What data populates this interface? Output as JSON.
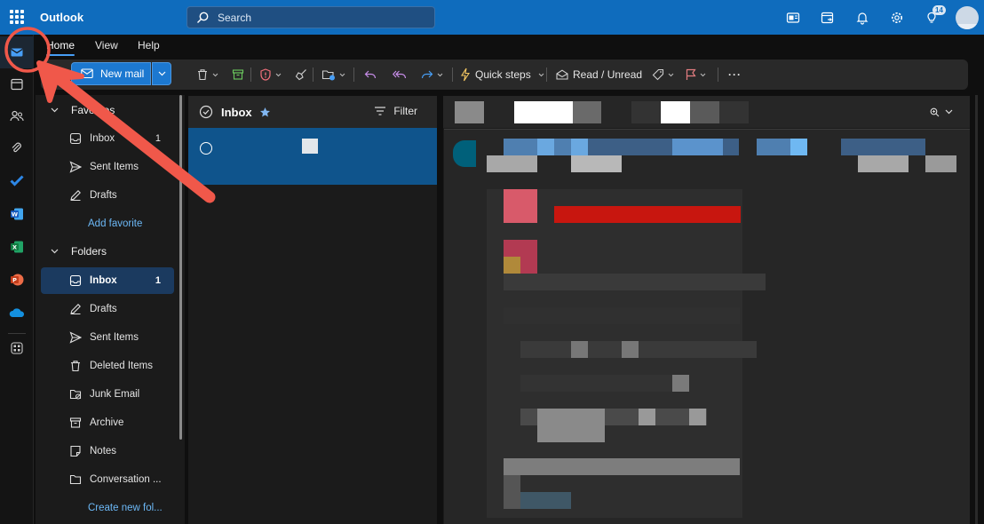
{
  "app": {
    "title": "Outlook"
  },
  "search": {
    "placeholder": "Search"
  },
  "topbar": {
    "icons": [
      "teams-meeting-icon",
      "my-day-icon",
      "bell-icon",
      "gear-icon",
      "lightbulb-icon"
    ],
    "tips_badge": "14"
  },
  "rail": {
    "items": [
      "mail-icon",
      "calendar-icon",
      "people-icon",
      "attach-icon",
      "todo-icon",
      "word-icon",
      "excel-icon",
      "powerpoint-icon",
      "onedrive-icon",
      "more-apps-icon"
    ]
  },
  "ribbon": {
    "tabs": [
      {
        "label": "Home"
      },
      {
        "label": "View"
      },
      {
        "label": "Help"
      }
    ],
    "new_mail": "New mail",
    "quick_steps": "Quick steps",
    "read_unread": "Read / Unread",
    "more": "···"
  },
  "folders": {
    "favorites_header": "Favorites",
    "favorites": [
      {
        "label": "Inbox",
        "count": "1"
      },
      {
        "label": "Sent Items"
      },
      {
        "label": "Drafts"
      }
    ],
    "add_favorite": "Add favorite",
    "folders_header": "Folders",
    "items": [
      {
        "label": "Inbox",
        "count": "1"
      },
      {
        "label": "Drafts"
      },
      {
        "label": "Sent Items"
      },
      {
        "label": "Deleted Items"
      },
      {
        "label": "Junk Email"
      },
      {
        "label": "Archive"
      },
      {
        "label": "Notes"
      },
      {
        "label": "Conversation ..."
      }
    ],
    "create_new": "Create new fol..."
  },
  "list": {
    "title": "Inbox",
    "filter": "Filter"
  },
  "colors": {
    "brand": "#0f6cbd",
    "selection": "#0f548c",
    "annotation": "#f0584a",
    "link": "#6cb8f6"
  }
}
